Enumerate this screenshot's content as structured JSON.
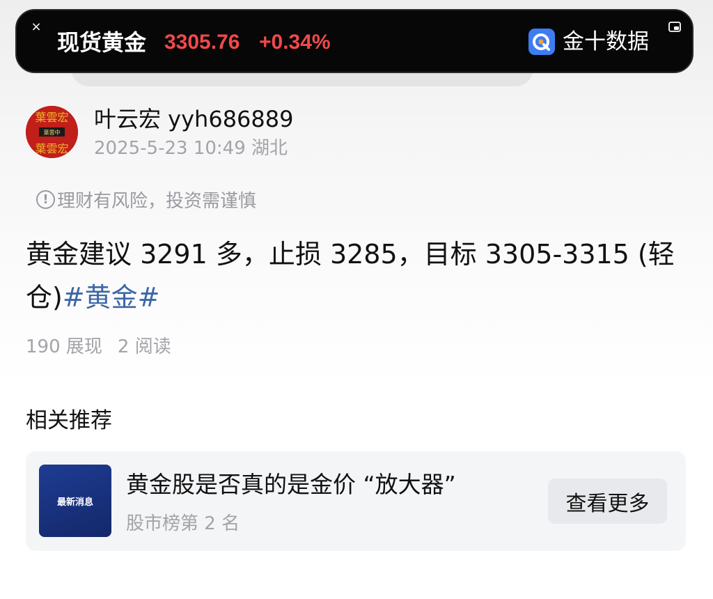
{
  "ticker": {
    "close_glyph": "×",
    "name": "现货黄金",
    "price": "3305.76",
    "change": "+0.34%",
    "brand": "金十数据",
    "color_up": "#f0494a"
  },
  "post": {
    "author": "叶云宏 yyh686889",
    "meta": "2025-5-23 10:49  湖北",
    "avatar_text": {
      "top": "葉雲宏",
      "middle": "葉雲中",
      "bottom": "葉雲宏"
    },
    "risk_icon": "!",
    "risk_notice": "理财有风险，投资需谨慎",
    "body_text": "黄金建议 3291 多，止损 3285，目标 3305-3315 (轻仓)",
    "hashtag": "#黄金#",
    "impressions": "190 展现",
    "reads": "2 阅读"
  },
  "recommendations": {
    "section_title": "相关推荐",
    "items": [
      {
        "thumb_label": "最新消息",
        "title": "黄金股是否真的是金价 “放大器”",
        "subtitle": "股市榜第 2 名",
        "more_label": "查看更多"
      }
    ]
  },
  "colors": {
    "accent_link": "#3d67a6",
    "ticker_bg": "#070707",
    "avatar_red": "#c01f1a",
    "thumb_blue": "#1e3c92"
  },
  "icons": [
    "close-icon",
    "brand-logo-icon",
    "pip-icon",
    "info-icon"
  ]
}
